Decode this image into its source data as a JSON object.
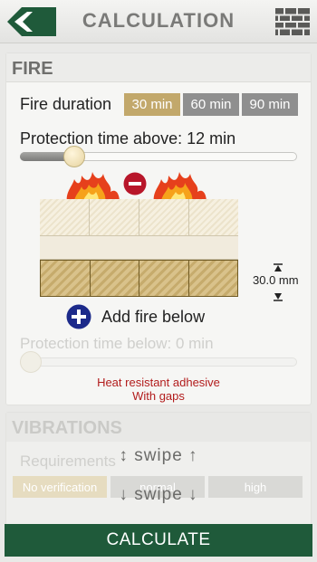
{
  "header": {
    "title": "CALCULATION",
    "back_icon": "back-arrow-icon",
    "wall_icon": "brick-wall-icon"
  },
  "fire": {
    "heading": "FIRE",
    "duration_label": "Fire duration",
    "duration_options": [
      "30 min",
      "60 min",
      "90 min"
    ],
    "duration_selected": "30 min",
    "protection_above_label": "Protection time above: 12 min",
    "protection_above_level": 0.17,
    "insulation_thickness": "30.0 mm",
    "add_fire_below": "Add fire below",
    "protection_below_label": "Protection time below: 0 min",
    "protection_below_level": 0.0,
    "adhesive_line1": "Heat resistant adhesive",
    "adhesive_line2": "With gaps"
  },
  "vibrations": {
    "heading": "VIBRATIONS",
    "requirements_label": "Requirements",
    "options": [
      "No verification",
      "normal",
      "high"
    ],
    "selected": "No verification"
  },
  "swipe": {
    "up": "↕ swipe ↑",
    "down": "↓ swipe ↓"
  },
  "calculate_label": "CALCULATE",
  "colors": {
    "accent_gold": "#c2a86b",
    "brand_green": "#1f5a3a",
    "alert_red": "#b21c1c",
    "add_blue": "#1c2a8a"
  }
}
